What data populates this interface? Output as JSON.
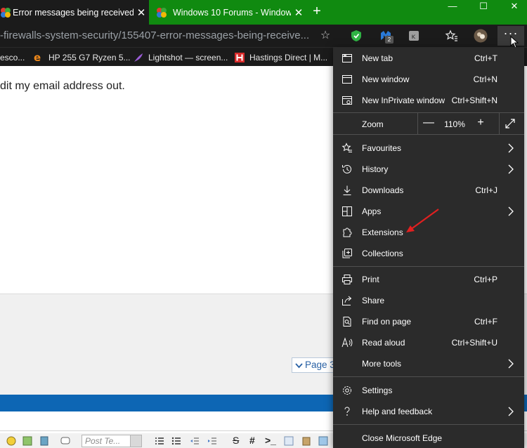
{
  "tabs": [
    {
      "title": "Error messages being received -",
      "close": "✕"
    },
    {
      "title": "Windows 10 Forums - Windows",
      "close": "✕"
    }
  ],
  "new_tab_symbol": "+",
  "window_controls": {
    "minimize": "—",
    "maximize": "☐",
    "close": "✕"
  },
  "address_bar": {
    "url": "-firewalls-system-security/155407-error-messages-being-receive...",
    "star_symbol": "☆"
  },
  "toolbar": {
    "badge": "2",
    "more_symbol": "···"
  },
  "favorites": [
    {
      "label": "esco...",
      "icon": "none"
    },
    {
      "label": "HP 255 G7 Ryzen 5...",
      "icon": "e-logo-icon"
    },
    {
      "label": "Lightshot — screen...",
      "icon": "feather-icon"
    },
    {
      "label": "Hastings Direct | M...",
      "icon": "h-logo-icon"
    }
  ],
  "page": {
    "post_text": "dit my email address out.",
    "pager_label": "Page 3",
    "editor_font_placeholder": "Post Te...",
    "editor_symbols": {
      "strike": "S",
      "hash": "#",
      "prompt": ">_"
    }
  },
  "menu": {
    "items": [
      {
        "id": "new-tab",
        "label": "New tab",
        "shortcut": "Ctrl+T",
        "icon": "new-tab-icon"
      },
      {
        "id": "new-window",
        "label": "New window",
        "shortcut": "Ctrl+N",
        "icon": "new-window-icon"
      },
      {
        "id": "new-inprivate",
        "label": "New InPrivate window",
        "shortcut": "Ctrl+Shift+N",
        "icon": "inprivate-icon"
      },
      {
        "id": "favourites",
        "label": "Favourites",
        "shortcut": "",
        "icon": "favourites-icon",
        "submenu": true
      },
      {
        "id": "history",
        "label": "History",
        "shortcut": "",
        "icon": "history-icon",
        "submenu": true
      },
      {
        "id": "downloads",
        "label": "Downloads",
        "shortcut": "Ctrl+J",
        "icon": "download-icon"
      },
      {
        "id": "apps",
        "label": "Apps",
        "shortcut": "",
        "icon": "apps-icon",
        "submenu": true
      },
      {
        "id": "extensions",
        "label": "Extensions",
        "shortcut": "",
        "icon": "extensions-icon"
      },
      {
        "id": "collections",
        "label": "Collections",
        "shortcut": "",
        "icon": "collections-icon"
      },
      {
        "id": "print",
        "label": "Print",
        "shortcut": "Ctrl+P",
        "icon": "print-icon"
      },
      {
        "id": "share",
        "label": "Share",
        "shortcut": "",
        "icon": "share-icon"
      },
      {
        "id": "find-on-page",
        "label": "Find on page",
        "shortcut": "Ctrl+F",
        "icon": "find-icon"
      },
      {
        "id": "read-aloud",
        "label": "Read aloud",
        "shortcut": "Ctrl+Shift+U",
        "icon": "read-aloud-icon"
      },
      {
        "id": "more-tools",
        "label": "More tools",
        "shortcut": "",
        "icon": "",
        "submenu": true
      },
      {
        "id": "settings",
        "label": "Settings",
        "shortcut": "",
        "icon": "settings-icon"
      },
      {
        "id": "help-feedback",
        "label": "Help and feedback",
        "shortcut": "",
        "icon": "help-icon",
        "submenu": true
      },
      {
        "id": "close-edge",
        "label": "Close Microsoft Edge",
        "shortcut": "",
        "icon": ""
      }
    ],
    "zoom": {
      "label": "Zoom",
      "minus": "—",
      "value": "110%",
      "plus": "+"
    }
  },
  "colors": {
    "tab_strip": "#108a10",
    "toolbar_bg": "#1b1b1b",
    "menu_bg": "#2b2b2b",
    "annotation_arrow": "#e02020",
    "blue_bar": "#0d66b4",
    "link_blue": "#2a62a5"
  }
}
